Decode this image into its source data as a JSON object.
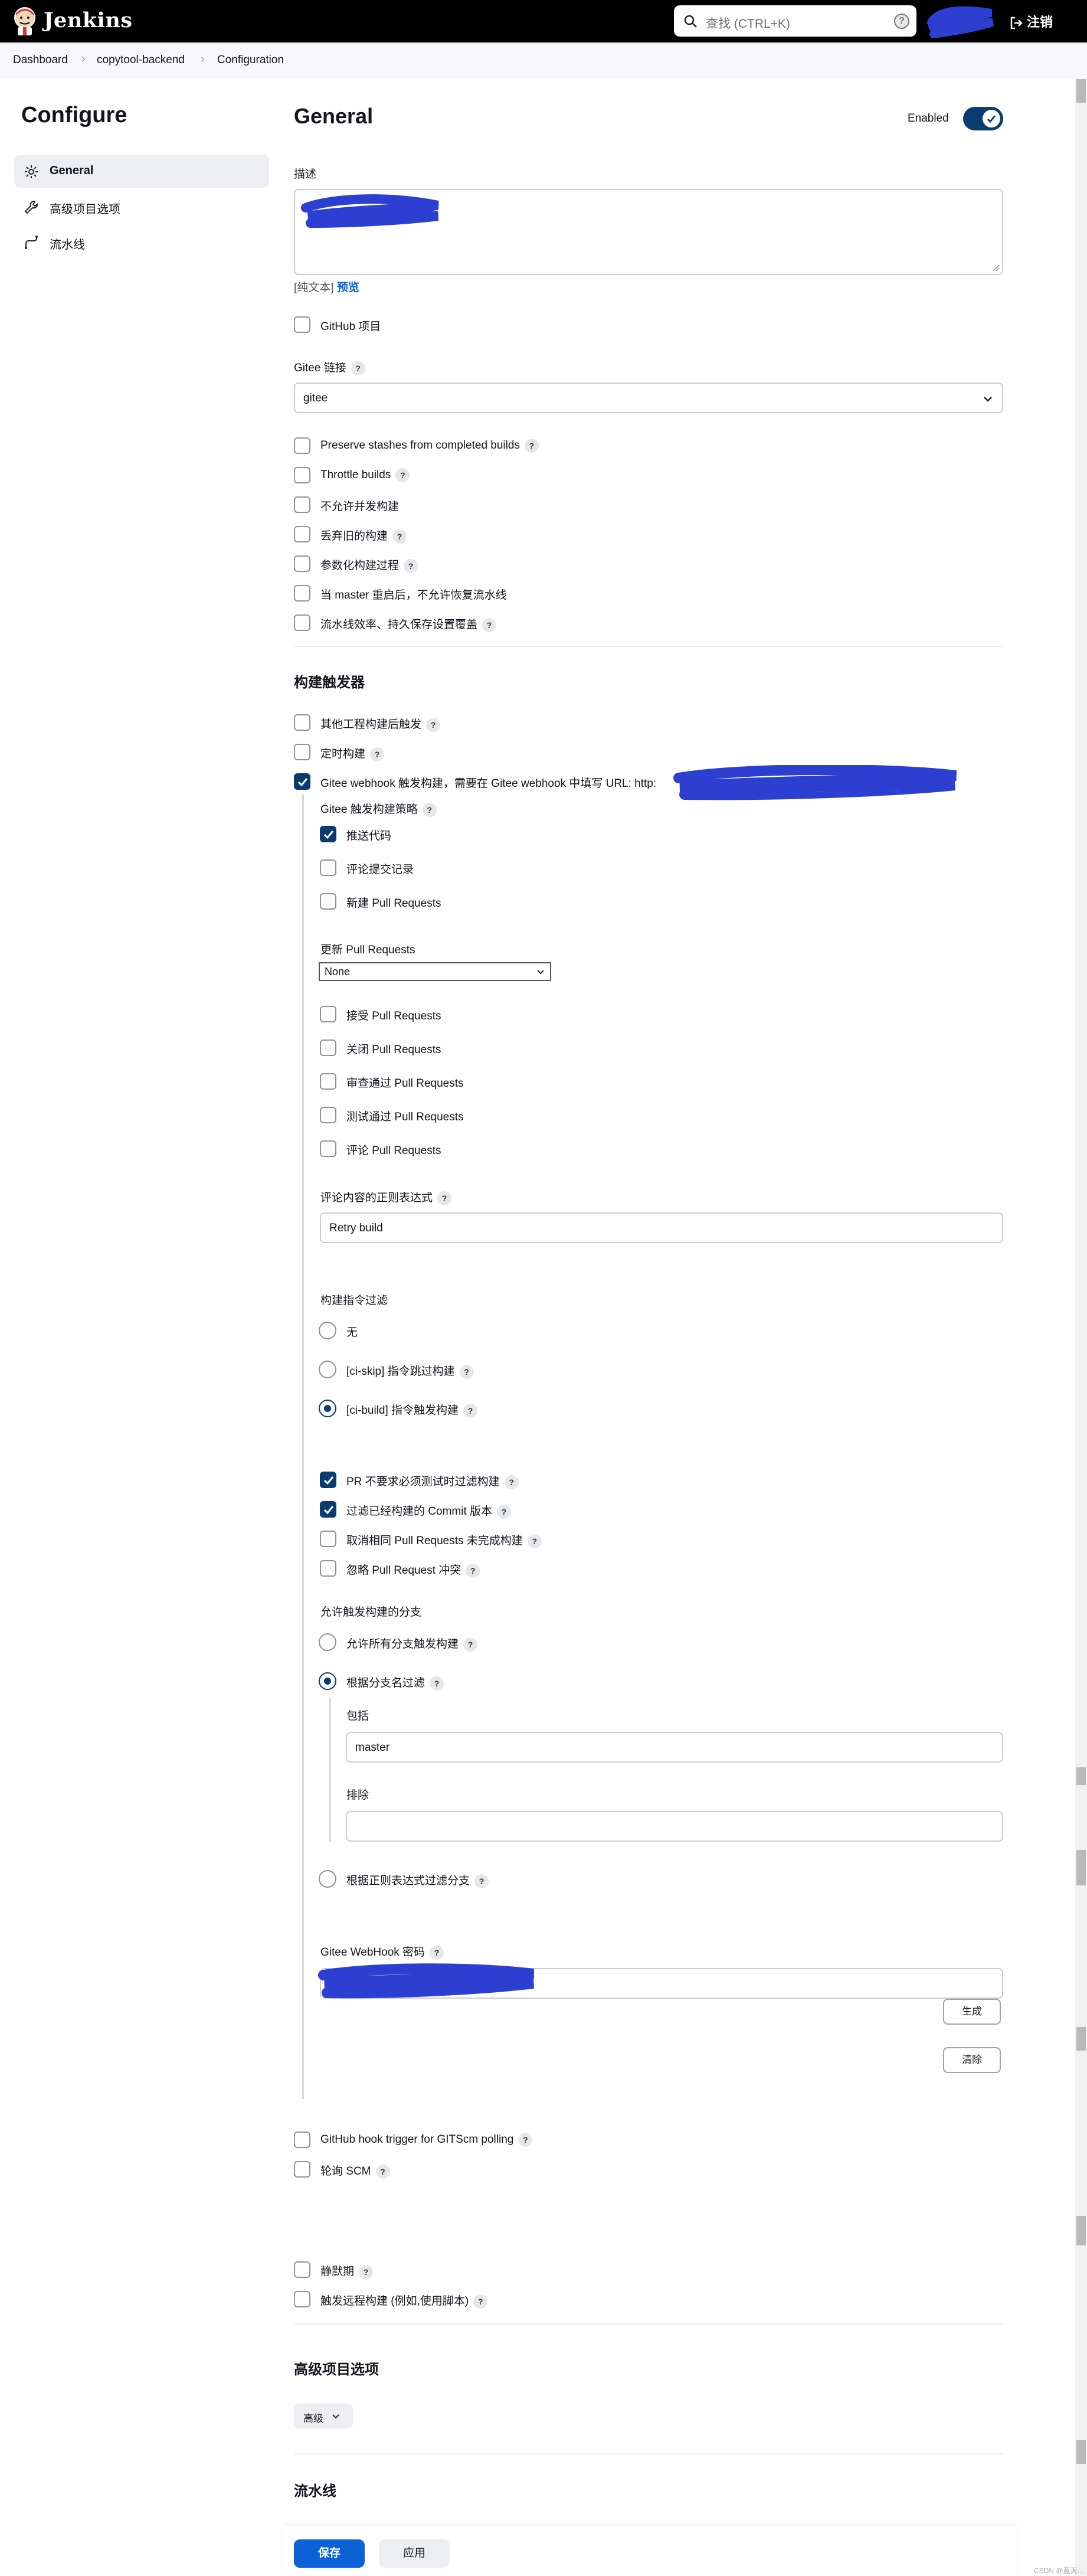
{
  "header": {
    "brand": "Jenkins",
    "search_placeholder": "查找 (CTRL+K)",
    "search_help": "?",
    "logout": "注销"
  },
  "breadcrumb": [
    "Dashboard",
    "copytool-backend",
    "Configuration"
  ],
  "sidebar": {
    "title": "Configure",
    "items": [
      {
        "label": "General",
        "icon": "gear-icon",
        "active": true
      },
      {
        "label": "高级项目选项",
        "icon": "wrench-icon",
        "active": false
      },
      {
        "label": "流水线",
        "icon": "pipeline-icon",
        "active": false
      }
    ]
  },
  "general": {
    "title": "General",
    "enabled_label": "Enabled",
    "enabled": true,
    "description_label": "描述",
    "plain_text": "[纯文本]",
    "preview": "预览",
    "github_project": "GitHub 项目",
    "gitee_link_label": "Gitee 链接",
    "gitee_link_value": "gitee",
    "options": [
      {
        "label": "Preserve stashes from completed builds",
        "help": true
      },
      {
        "label": "Throttle builds",
        "help": true
      },
      {
        "label": "不允许并发构建",
        "help": false
      },
      {
        "label": "丢弃旧的构建",
        "help": true
      },
      {
        "label": "参数化构建过程",
        "help": true
      },
      {
        "label": "当 master 重启后，不允许恢复流水线",
        "help": false
      },
      {
        "label": "流水线效率、持久保存设置覆盖",
        "help": true
      }
    ]
  },
  "triggers": {
    "title": "构建触发器",
    "after_other": "其他工程构建后触发",
    "scheduled": "定时构建",
    "gitee_webhook": "Gitee webhook 触发构建，需要在 Gitee webhook 中填写 URL: http:",
    "strategy_label": "Gitee 触发构建策略",
    "strategy_options": [
      {
        "label": "推送代码",
        "checked": true
      },
      {
        "label": "评论提交记录",
        "checked": false
      },
      {
        "label": "新建 Pull Requests",
        "checked": false
      }
    ],
    "update_pr_label": "更新 Pull Requests",
    "update_pr_value": "None",
    "pr_options": [
      "接受 Pull Requests",
      "关闭 Pull Requests",
      "审查通过 Pull Requests",
      "测试通过 Pull Requests",
      "评论 Pull Requests"
    ],
    "regex_label": "评论内容的正则表达式",
    "regex_value": "Retry build",
    "filter_label": "构建指令过滤",
    "filter_options": [
      {
        "label": "无",
        "checked": false,
        "help": false
      },
      {
        "label": "[ci-skip] 指令跳过构建",
        "checked": false,
        "help": true
      },
      {
        "label": "[ci-build] 指令触发构建",
        "checked": true,
        "help": true
      }
    ],
    "extra_options": [
      {
        "label": "PR 不要求必须测试时过滤构建",
        "checked": true
      },
      {
        "label": "过滤已经构建的 Commit 版本",
        "checked": true
      },
      {
        "label": "取消相同 Pull Requests 未完成构建",
        "checked": false
      },
      {
        "label": "忽略 Pull Request 冲突",
        "checked": false
      }
    ],
    "branch_label": "允许触发构建的分支",
    "branch_all": "允许所有分支触发构建",
    "branch_by_name": "根据分支名过滤",
    "include_label": "包括",
    "include_value": "master",
    "exclude_label": "排除",
    "exclude_value": "",
    "branch_regex": "根据正则表达式过滤分支",
    "secret_label": "Gitee WebHook 密码",
    "generate": "生成",
    "clear": "清除",
    "github_hook": "GitHub hook trigger for GITScm polling",
    "poll_scm": "轮询 SCM",
    "quiet_period": "静默期",
    "remote_trigger": "触发远程构建 (例如,使用脚本)"
  },
  "advanced": {
    "title": "高级项目选项",
    "button": "高级"
  },
  "pipeline": {
    "title": "流水线"
  },
  "footer": {
    "save": "保存",
    "apply": "应用",
    "watermark": "CSDN @蓝天..."
  },
  "colors": {
    "accent": "#0b3c70",
    "primary_button": "#0b62d6",
    "scribble": "#2c3fd1"
  }
}
